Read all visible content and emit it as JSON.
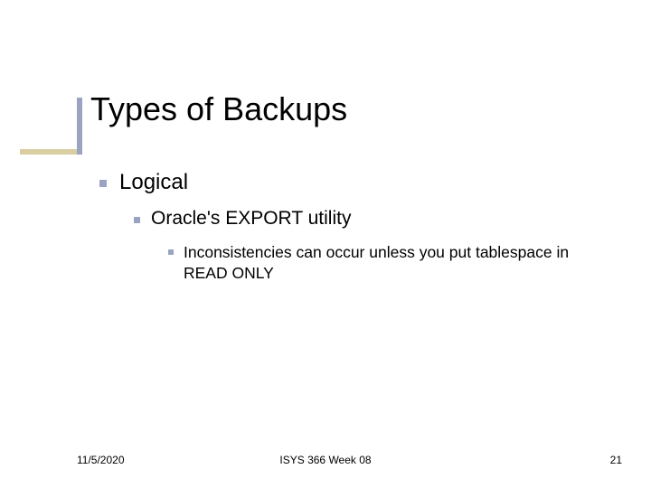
{
  "title": "Types of Backups",
  "bullets": {
    "level1": {
      "text": "Logical"
    },
    "level2": {
      "text": "Oracle's EXPORT utility"
    },
    "level3": {
      "text": "Inconsistencies can occur unless you put tablespace in READ ONLY"
    }
  },
  "footer": {
    "date": "11/5/2020",
    "center": "ISYS 366  Week 08",
    "page": "21"
  }
}
